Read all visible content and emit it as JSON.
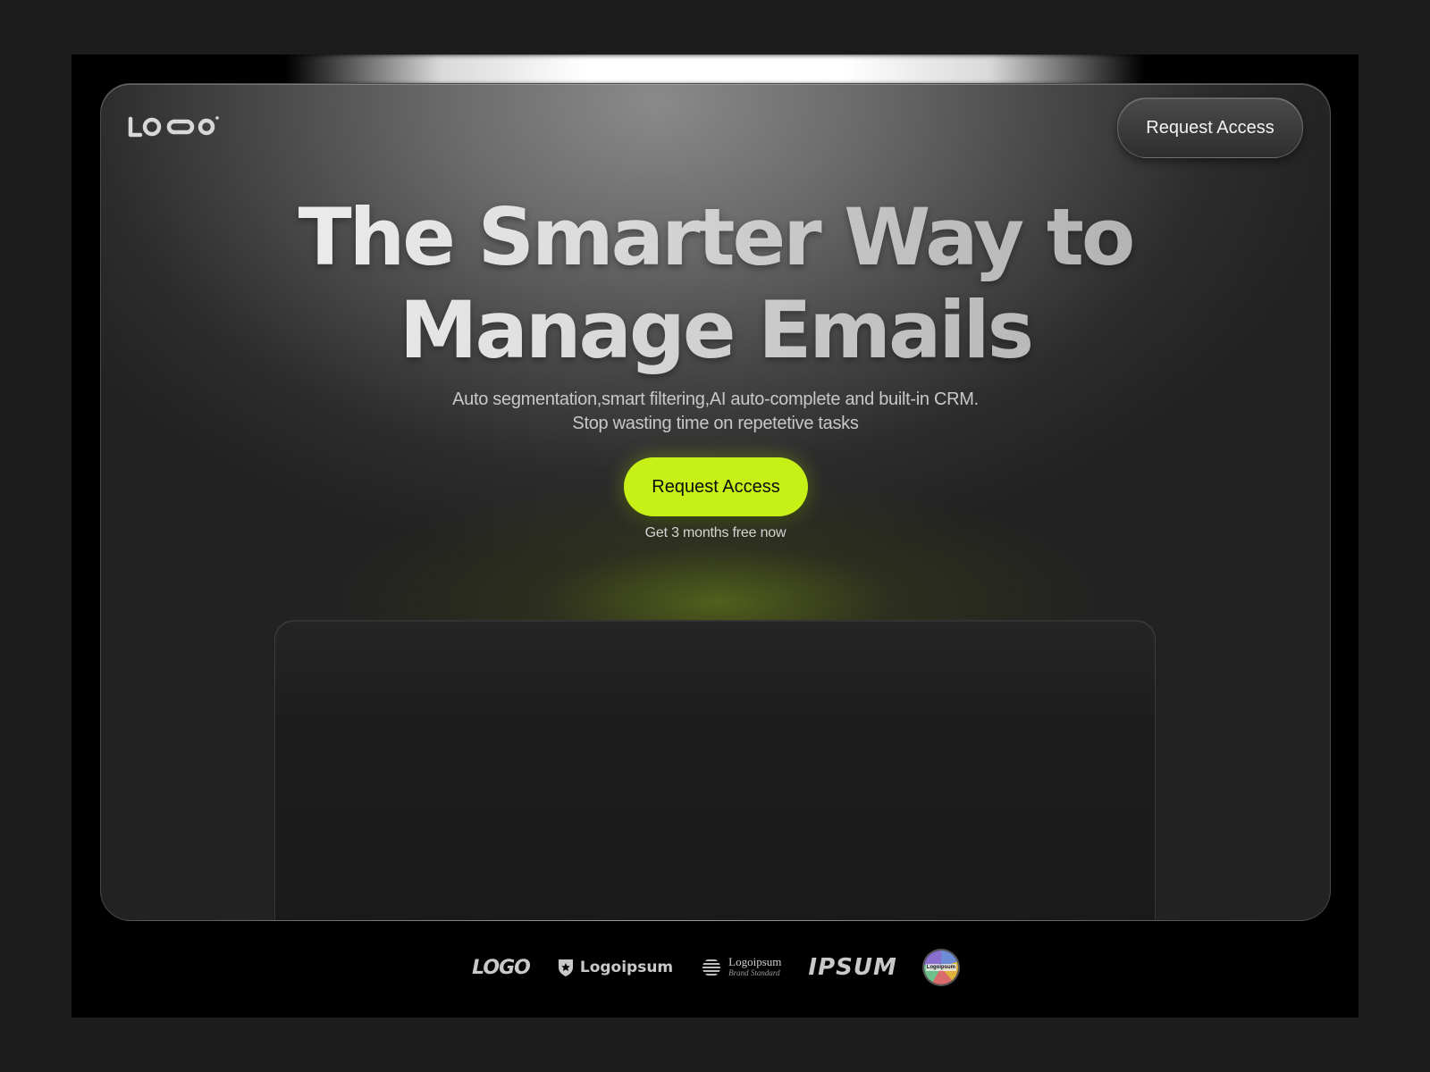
{
  "brand": {
    "logo_text": "LOGO"
  },
  "nav": {
    "request_label": "Request Access"
  },
  "hero": {
    "headline_line1": "The Smarter Way to",
    "headline_line2": "Manage Emails",
    "subtitle_line1": "Auto segmentation,smart filtering,AI auto-complete and built-in CRM.",
    "subtitle_line2": "Stop wasting time on repetetive tasks",
    "cta_label": "Request Access",
    "cta_note": "Get 3 months free now"
  },
  "partners": [
    {
      "icon": "logoipsum-mark-1",
      "text": "LOGO"
    },
    {
      "icon": "shield-star-icon",
      "text": "Logoipsum"
    },
    {
      "icon": "striped-globe-icon",
      "text": "Logoipsum",
      "tagline": "Brand Standard"
    },
    {
      "icon": "ipsum-wordmark",
      "text": "IPSUM"
    },
    {
      "icon": "round-badge-logo",
      "text": "Logoipsum"
    }
  ],
  "colors": {
    "page_bg": "#1c1c1c",
    "frame_bg": "#000000",
    "accent": "#c6f016",
    "headline": "#e6e6e6",
    "subtitle": "#c8c8c8"
  }
}
